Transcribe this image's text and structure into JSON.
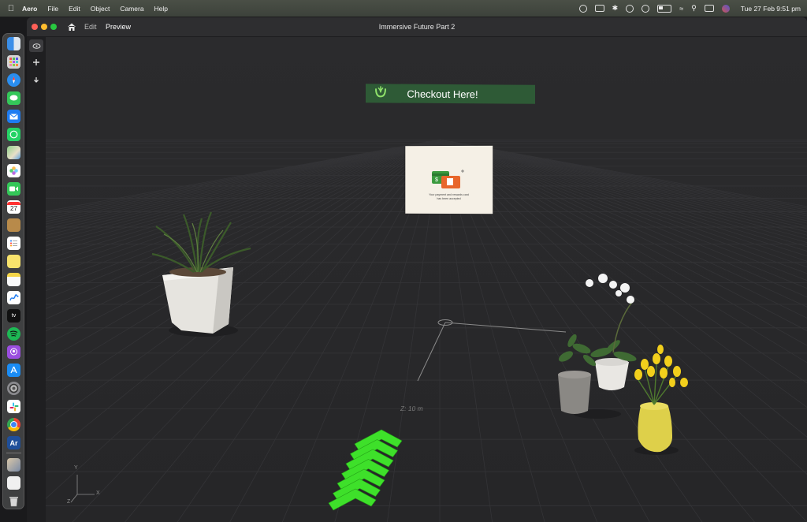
{
  "menubar": {
    "app_name": "Aero",
    "menus": [
      "File",
      "Edit",
      "Object",
      "Camera",
      "Help"
    ],
    "clock": "Tue 27 Feb  9:51 pm"
  },
  "window": {
    "title": "Immersive Future Part 2",
    "nav_edit": "Edit",
    "nav_preview": "Preview"
  },
  "dock": {
    "apps": [
      "finder",
      "launchpad",
      "safari",
      "messages",
      "mail",
      "whatsapp",
      "maps",
      "photos",
      "facetime",
      "calendar",
      "notes-app",
      "reminders",
      "stickies",
      "notes",
      "freeform",
      "apple-tv",
      "spotify",
      "podcasts",
      "app-store",
      "system-settings",
      "slack",
      "chrome",
      "aero"
    ],
    "calendar_day": "27",
    "aero_badge": "Ar",
    "tv_label": "tv"
  },
  "scene": {
    "banner_text": "Checkout Here!",
    "card_caption_line1": "Your payment and rewards card",
    "card_caption_line2": "has been accepted",
    "z_label": "Z:  10 m",
    "axis": {
      "y": "Y",
      "x": "X",
      "z": "Z"
    }
  },
  "colors": {
    "banner_bg": "#2e5a36",
    "arrows": "#3ee02a",
    "grid": "#3a3a3d"
  }
}
